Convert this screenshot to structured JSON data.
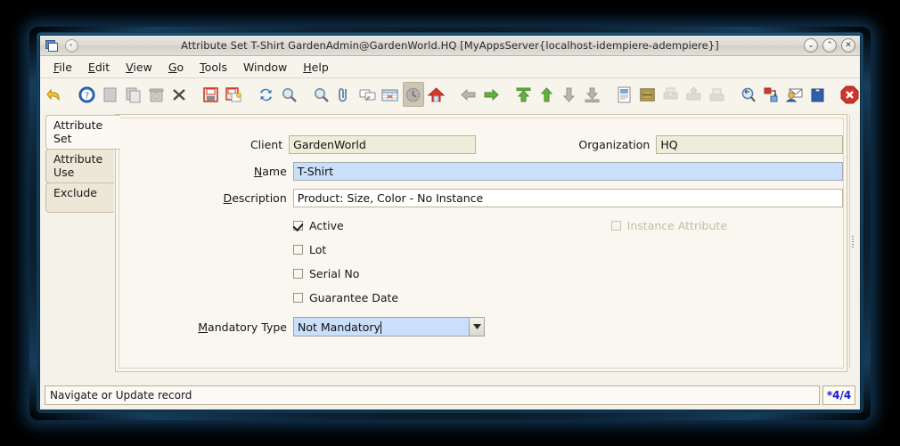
{
  "window": {
    "title": "Attribute Set  T-Shirt  GardenAdmin@GardenWorld.HQ [MyAppsServer{localhost-idempiere-adempiere}]",
    "minimize": "⌄",
    "maximize": "⌃",
    "close": "✕"
  },
  "menubar": [
    {
      "mnemonic": "F",
      "rest": "ile"
    },
    {
      "mnemonic": "E",
      "rest": "dit"
    },
    {
      "mnemonic": "V",
      "rest": "iew"
    },
    {
      "mnemonic": "G",
      "rest": "o"
    },
    {
      "mnemonic": "T",
      "rest": "ools"
    },
    {
      "mnemonic": "W",
      "rest": "indow"
    },
    {
      "mnemonic": "H",
      "rest": "elp"
    }
  ],
  "toolbar": [
    {
      "name": "undo-icon",
      "tip": "Undo"
    },
    {
      "name": "help-icon",
      "tip": "Help"
    },
    {
      "name": "new-record-icon",
      "tip": "New Record"
    },
    {
      "name": "copy-record-icon",
      "tip": "Copy Record"
    },
    {
      "name": "delete-record-icon",
      "tip": "Delete Record"
    },
    {
      "name": "delete-selection-icon",
      "tip": "Delete Selection"
    },
    {
      "name": "save-icon",
      "tip": "Save Changes"
    },
    {
      "name": "save-new-icon",
      "tip": "Save and Create New"
    },
    {
      "name": "refresh-icon",
      "tip": "Refresh"
    },
    {
      "name": "find-icon",
      "tip": "Find"
    },
    {
      "name": "zoom-icon",
      "tip": "Zoom"
    },
    {
      "name": "attachment-icon",
      "tip": "Attachment"
    },
    {
      "name": "chat-icon",
      "tip": "Chat"
    },
    {
      "name": "grid-toggle-icon",
      "tip": "Toggle Grid"
    },
    {
      "name": "history-icon",
      "tip": "History Records"
    },
    {
      "name": "home-icon",
      "tip": "Home"
    },
    {
      "name": "previous-record-icon",
      "tip": "Previous Record"
    },
    {
      "name": "next-record-icon",
      "tip": "Next Record"
    },
    {
      "name": "first-record-icon",
      "tip": "First Record"
    },
    {
      "name": "parent-record-icon",
      "tip": "Parent Record"
    },
    {
      "name": "detail-record-icon",
      "tip": "Detail Record"
    },
    {
      "name": "last-record-icon",
      "tip": "Last Record"
    },
    {
      "name": "report-icon",
      "tip": "Report"
    },
    {
      "name": "archive-icon",
      "tip": "Archived Documents"
    },
    {
      "name": "print-preview-icon",
      "tip": "Print Preview"
    },
    {
      "name": "print-icon",
      "tip": "Print"
    },
    {
      "name": "print-screen-icon",
      "tip": "Print Screen"
    },
    {
      "name": "zoom-across-icon",
      "tip": "Zoom Across"
    },
    {
      "name": "workflow-icon",
      "tip": "Active Workflows"
    },
    {
      "name": "request-icon",
      "tip": "Requests"
    },
    {
      "name": "product-info-icon",
      "tip": "Product Info"
    },
    {
      "name": "exit-icon",
      "tip": "Exit"
    }
  ],
  "tabs": [
    {
      "label": "Attribute Set",
      "selected": true
    },
    {
      "label": "Attribute Use",
      "selected": false
    },
    {
      "label": "Exclude",
      "selected": false
    }
  ],
  "form": {
    "client": {
      "label": "Client",
      "value": "GardenWorld"
    },
    "organization": {
      "label": "Organization",
      "value": "HQ"
    },
    "name": {
      "label_mnemonic": "N",
      "label_rest": "ame",
      "value": "T-Shirt"
    },
    "description": {
      "label_mnemonic": "D",
      "label_rest": "escription",
      "value": "Product: Size, Color - No Instance"
    },
    "active": {
      "label": "Active",
      "checked": true
    },
    "instance_attribute": {
      "label": "Instance Attribute",
      "checked": false,
      "disabled": true
    },
    "lot": {
      "label": "Lot",
      "checked": false
    },
    "serial_no": {
      "label": "Serial No",
      "checked": false
    },
    "guarantee_date": {
      "label": "Guarantee Date",
      "checked": false
    },
    "mandatory_type": {
      "label_mnemonic": "M",
      "label_rest": "andatory Type",
      "value": "Not Mandatory"
    }
  },
  "statusbar": {
    "message": "Navigate or Update record",
    "record_count": "*4/4"
  },
  "colors": {
    "mandatory_field": "#c9dffa",
    "readonly_field": "#eeedda",
    "panel_bg": "#faf7f0",
    "window_chrome": "#f7f4ec",
    "record_count_text": "#1518d6",
    "title_gradient_top": "#e9e7e1"
  }
}
